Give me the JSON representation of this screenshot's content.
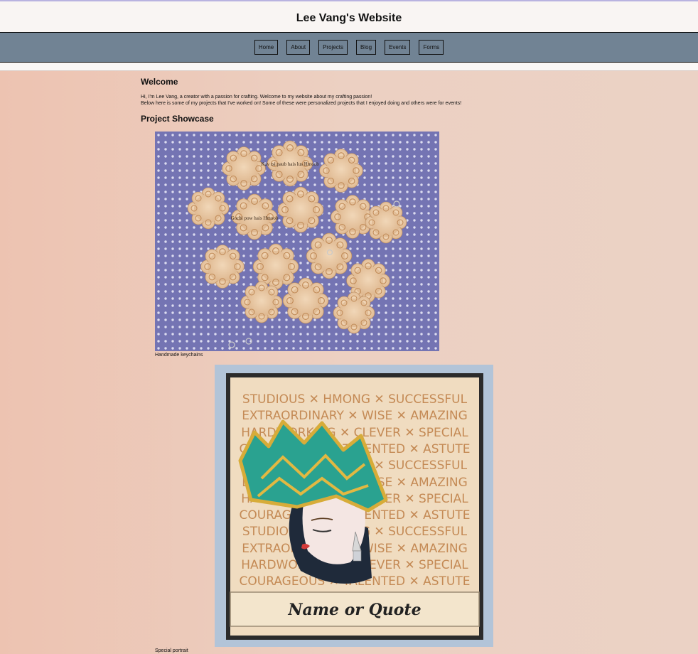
{
  "header": {
    "title": "Lee Vang's Website"
  },
  "nav": {
    "items": [
      {
        "label": "Home"
      },
      {
        "label": "About"
      },
      {
        "label": "Projects"
      },
      {
        "label": "Blog"
      },
      {
        "label": "Events"
      },
      {
        "label": "Forms"
      }
    ]
  },
  "welcome": {
    "title": "Welcome",
    "line1": "Hi, I'm Lee Vang, a creator with a passion for crafting. Welcome to my website about my crafting passion!",
    "line2": "Below here is some of my projects that I've worked on! Some of these were personalized projects that I enjoyed doing and others were for events!"
  },
  "showcase": {
    "title": "Project Showcase",
    "projects": [
      {
        "caption": "Handmade keychains",
        "engraving_a": "Kuv tsi paub hais lus Hmoob",
        "engraving_b": "Gochi pow hais Hmoob"
      },
      {
        "caption": "Special portrait",
        "words": [
          "STUDIOUS ✕ HMONG ✕ SUCCESSFUL",
          "EXTRAORDINARY ✕ WISE ✕ AMAZING",
          "HARDWORKING ✕ CLEVER ✕ SPECIAL",
          "COURAGEOUS ✕ TALENTED ✕ ASTUTE"
        ],
        "plaque_text": "Name or Quote"
      }
    ]
  },
  "colors": {
    "nav_bg": "#718394",
    "header_bg": "#f9f5f3",
    "accent_line": "#b9b3e0"
  }
}
